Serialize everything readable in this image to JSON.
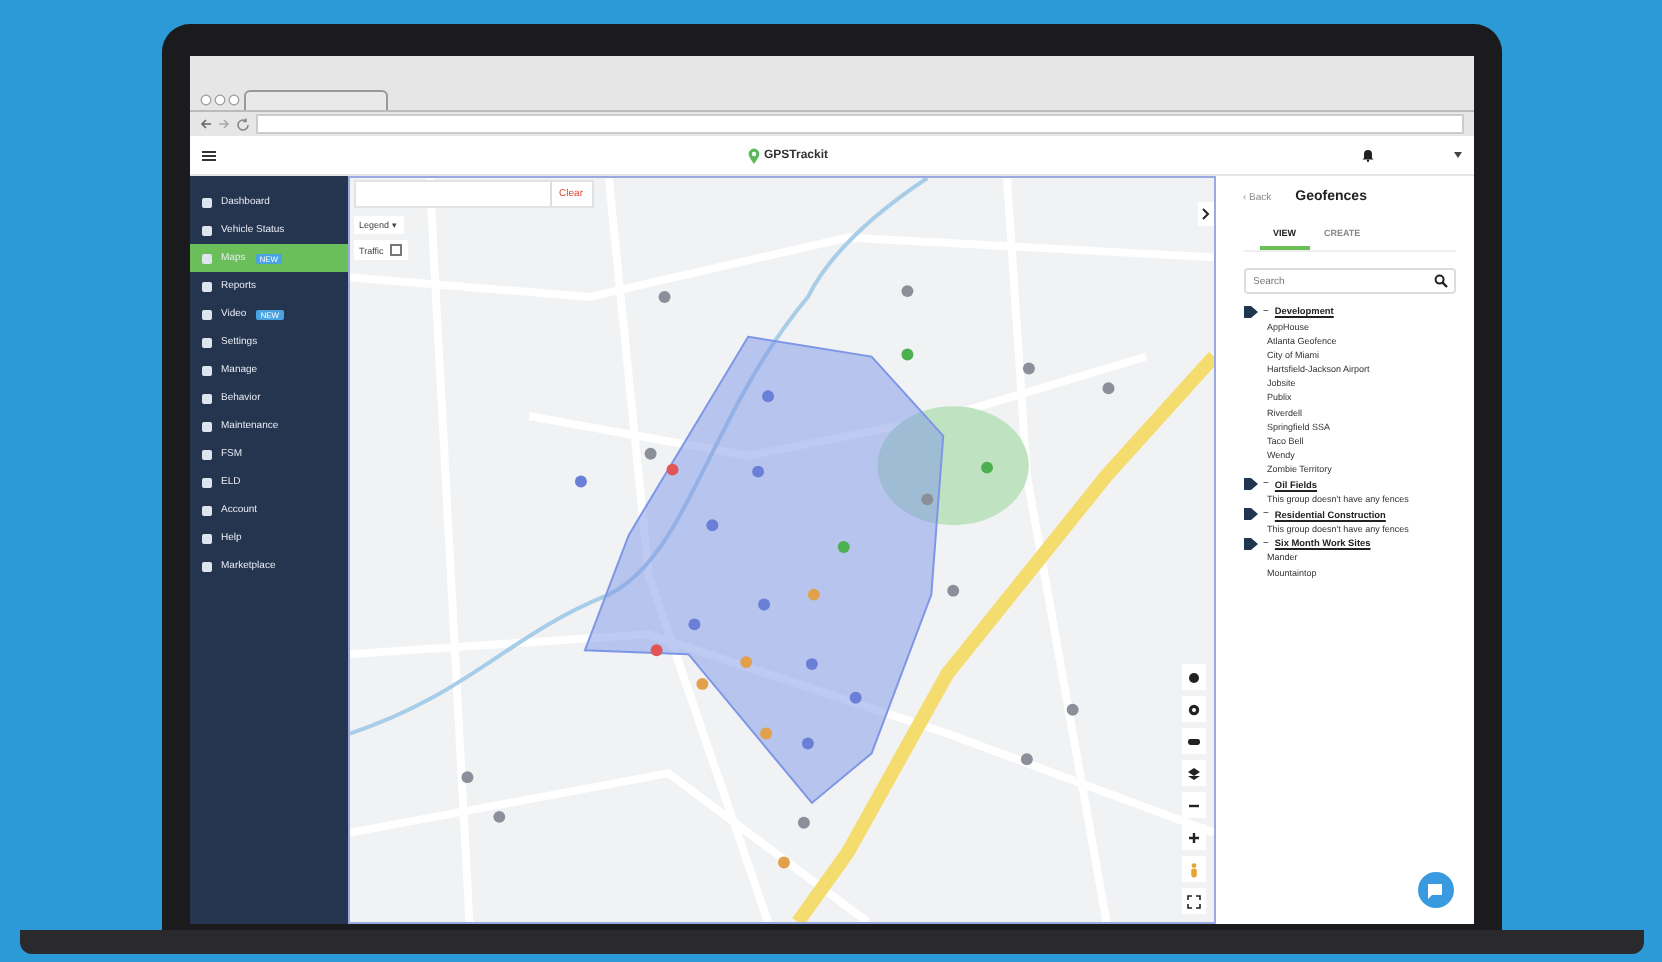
{
  "header": {
    "logo": "GPSTrackit"
  },
  "sidebar": {
    "items": [
      {
        "label": "Dashboard",
        "selected": false
      },
      {
        "label": "Vehicle Status",
        "selected": false
      },
      {
        "label": "Maps",
        "selected": true,
        "badge": "NEW"
      },
      {
        "label": "Reports",
        "selected": false
      },
      {
        "label": "Video",
        "selected": false,
        "badge": "NEW"
      },
      {
        "label": "Settings",
        "selected": false
      },
      {
        "label": "Manage",
        "selected": false
      },
      {
        "label": "Behavior",
        "selected": false
      },
      {
        "label": "Maintenance",
        "selected": false
      },
      {
        "label": "FSM",
        "selected": false
      },
      {
        "label": "ELD",
        "selected": false
      },
      {
        "label": "Account",
        "selected": false
      },
      {
        "label": "Help",
        "selected": false
      },
      {
        "label": "Marketplace",
        "selected": false
      }
    ]
  },
  "map": {
    "clear_button": "Clear",
    "legend": "Legend ▾",
    "traffic": {
      "label": "Traffic",
      "checked": false
    }
  },
  "panel": {
    "back": "‹ Back",
    "title": "Geofences",
    "tabs": [
      {
        "label": "VIEW",
        "selected": true
      },
      {
        "label": "CREATE",
        "selected": false
      }
    ],
    "search": {
      "placeholder": "Search"
    },
    "groups": [
      {
        "toggle": "−",
        "name": "Development",
        "children": [
          "AppHouse",
          "Atlanta Geofence",
          "City of Miami",
          "Hartsfield-Jackson Airport",
          "Jobsite",
          "Publix",
          "Riverdell",
          "Springfield SSA",
          "Taco Bell",
          "Wendy",
          "Zombie Territory"
        ]
      },
      {
        "toggle": "−",
        "name": "Oil Fields",
        "empty": "This group doesn't have any fences"
      },
      {
        "toggle": "−",
        "name": "Residential Construction",
        "empty": "This group doesn't have any fences"
      },
      {
        "toggle": "−",
        "name": "Six Month Work Sites",
        "children": [
          "Mander",
          "Mountaintop"
        ]
      }
    ]
  }
}
